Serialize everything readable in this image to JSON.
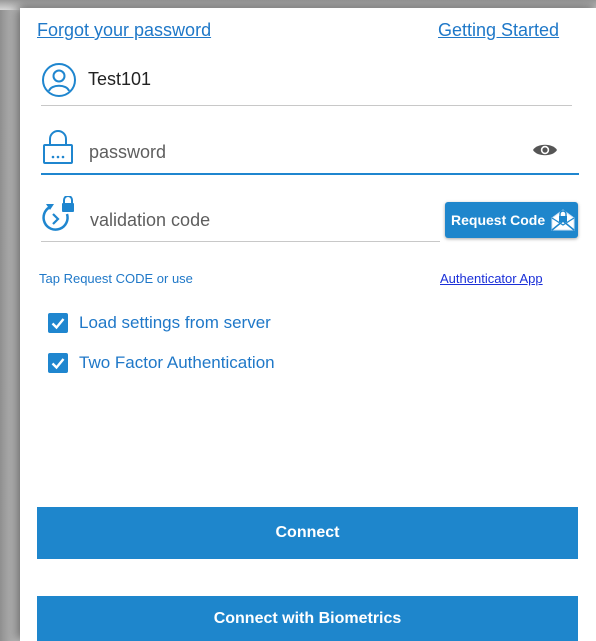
{
  "links": {
    "forgot_password": "Forgot your password",
    "getting_started": "Getting Started"
  },
  "username": {
    "value": "Test101"
  },
  "password": {
    "placeholder": "password"
  },
  "validation": {
    "placeholder": "validation code",
    "request_button": "Request Code"
  },
  "hint": {
    "text": "Tap Request CODE or use",
    "link": "Authenticator App"
  },
  "options": [
    {
      "label": "Load settings from server",
      "checked": true
    },
    {
      "label": "Two Factor Authentication",
      "checked": true
    }
  ],
  "buttons": {
    "connect": "Connect",
    "connect_biometrics": "Connect with Biometrics"
  },
  "colors": {
    "accent": "#1e86cc",
    "link": "#1f78c8",
    "hint_link": "#1a2fd8"
  },
  "icons": {
    "username": "user-circle-icon",
    "password": "lock-icon",
    "password_toggle": "eye-icon",
    "validation": "lock-refresh-icon",
    "request_code": "envelope-lock-icon",
    "checkbox": "checkmark-icon"
  }
}
